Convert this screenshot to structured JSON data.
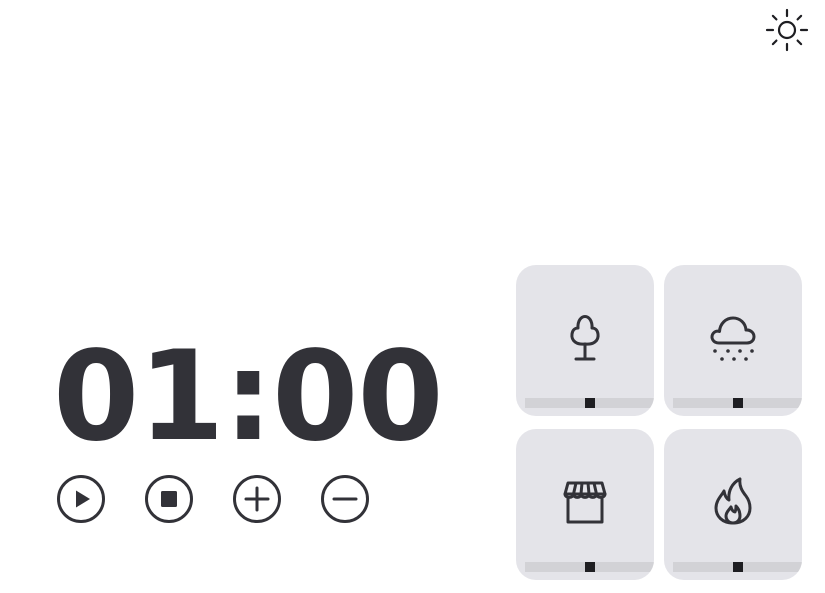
{
  "theme_toggle": {
    "icon": "sun-icon"
  },
  "timer": {
    "display": "01:00"
  },
  "controls": [
    {
      "name": "play-button",
      "icon": "play-icon"
    },
    {
      "name": "stop-button",
      "icon": "stop-icon"
    },
    {
      "name": "increase-button",
      "icon": "plus-icon"
    },
    {
      "name": "decrease-button",
      "icon": "minus-icon"
    }
  ],
  "sounds": [
    {
      "id": "forest",
      "icon": "tree-icon",
      "volume": 0.5
    },
    {
      "id": "rain",
      "icon": "rain-cloud-icon",
      "volume": 0.5
    },
    {
      "id": "coffee-shop",
      "icon": "storefront-icon",
      "volume": 0.5
    },
    {
      "id": "fireplace",
      "icon": "flame-icon",
      "volume": 0.5
    }
  ],
  "colors": {
    "text": "#323238",
    "tile_bg": "#e4e4e9",
    "track": "#d2d2d6",
    "knob": "#1e1e22"
  }
}
